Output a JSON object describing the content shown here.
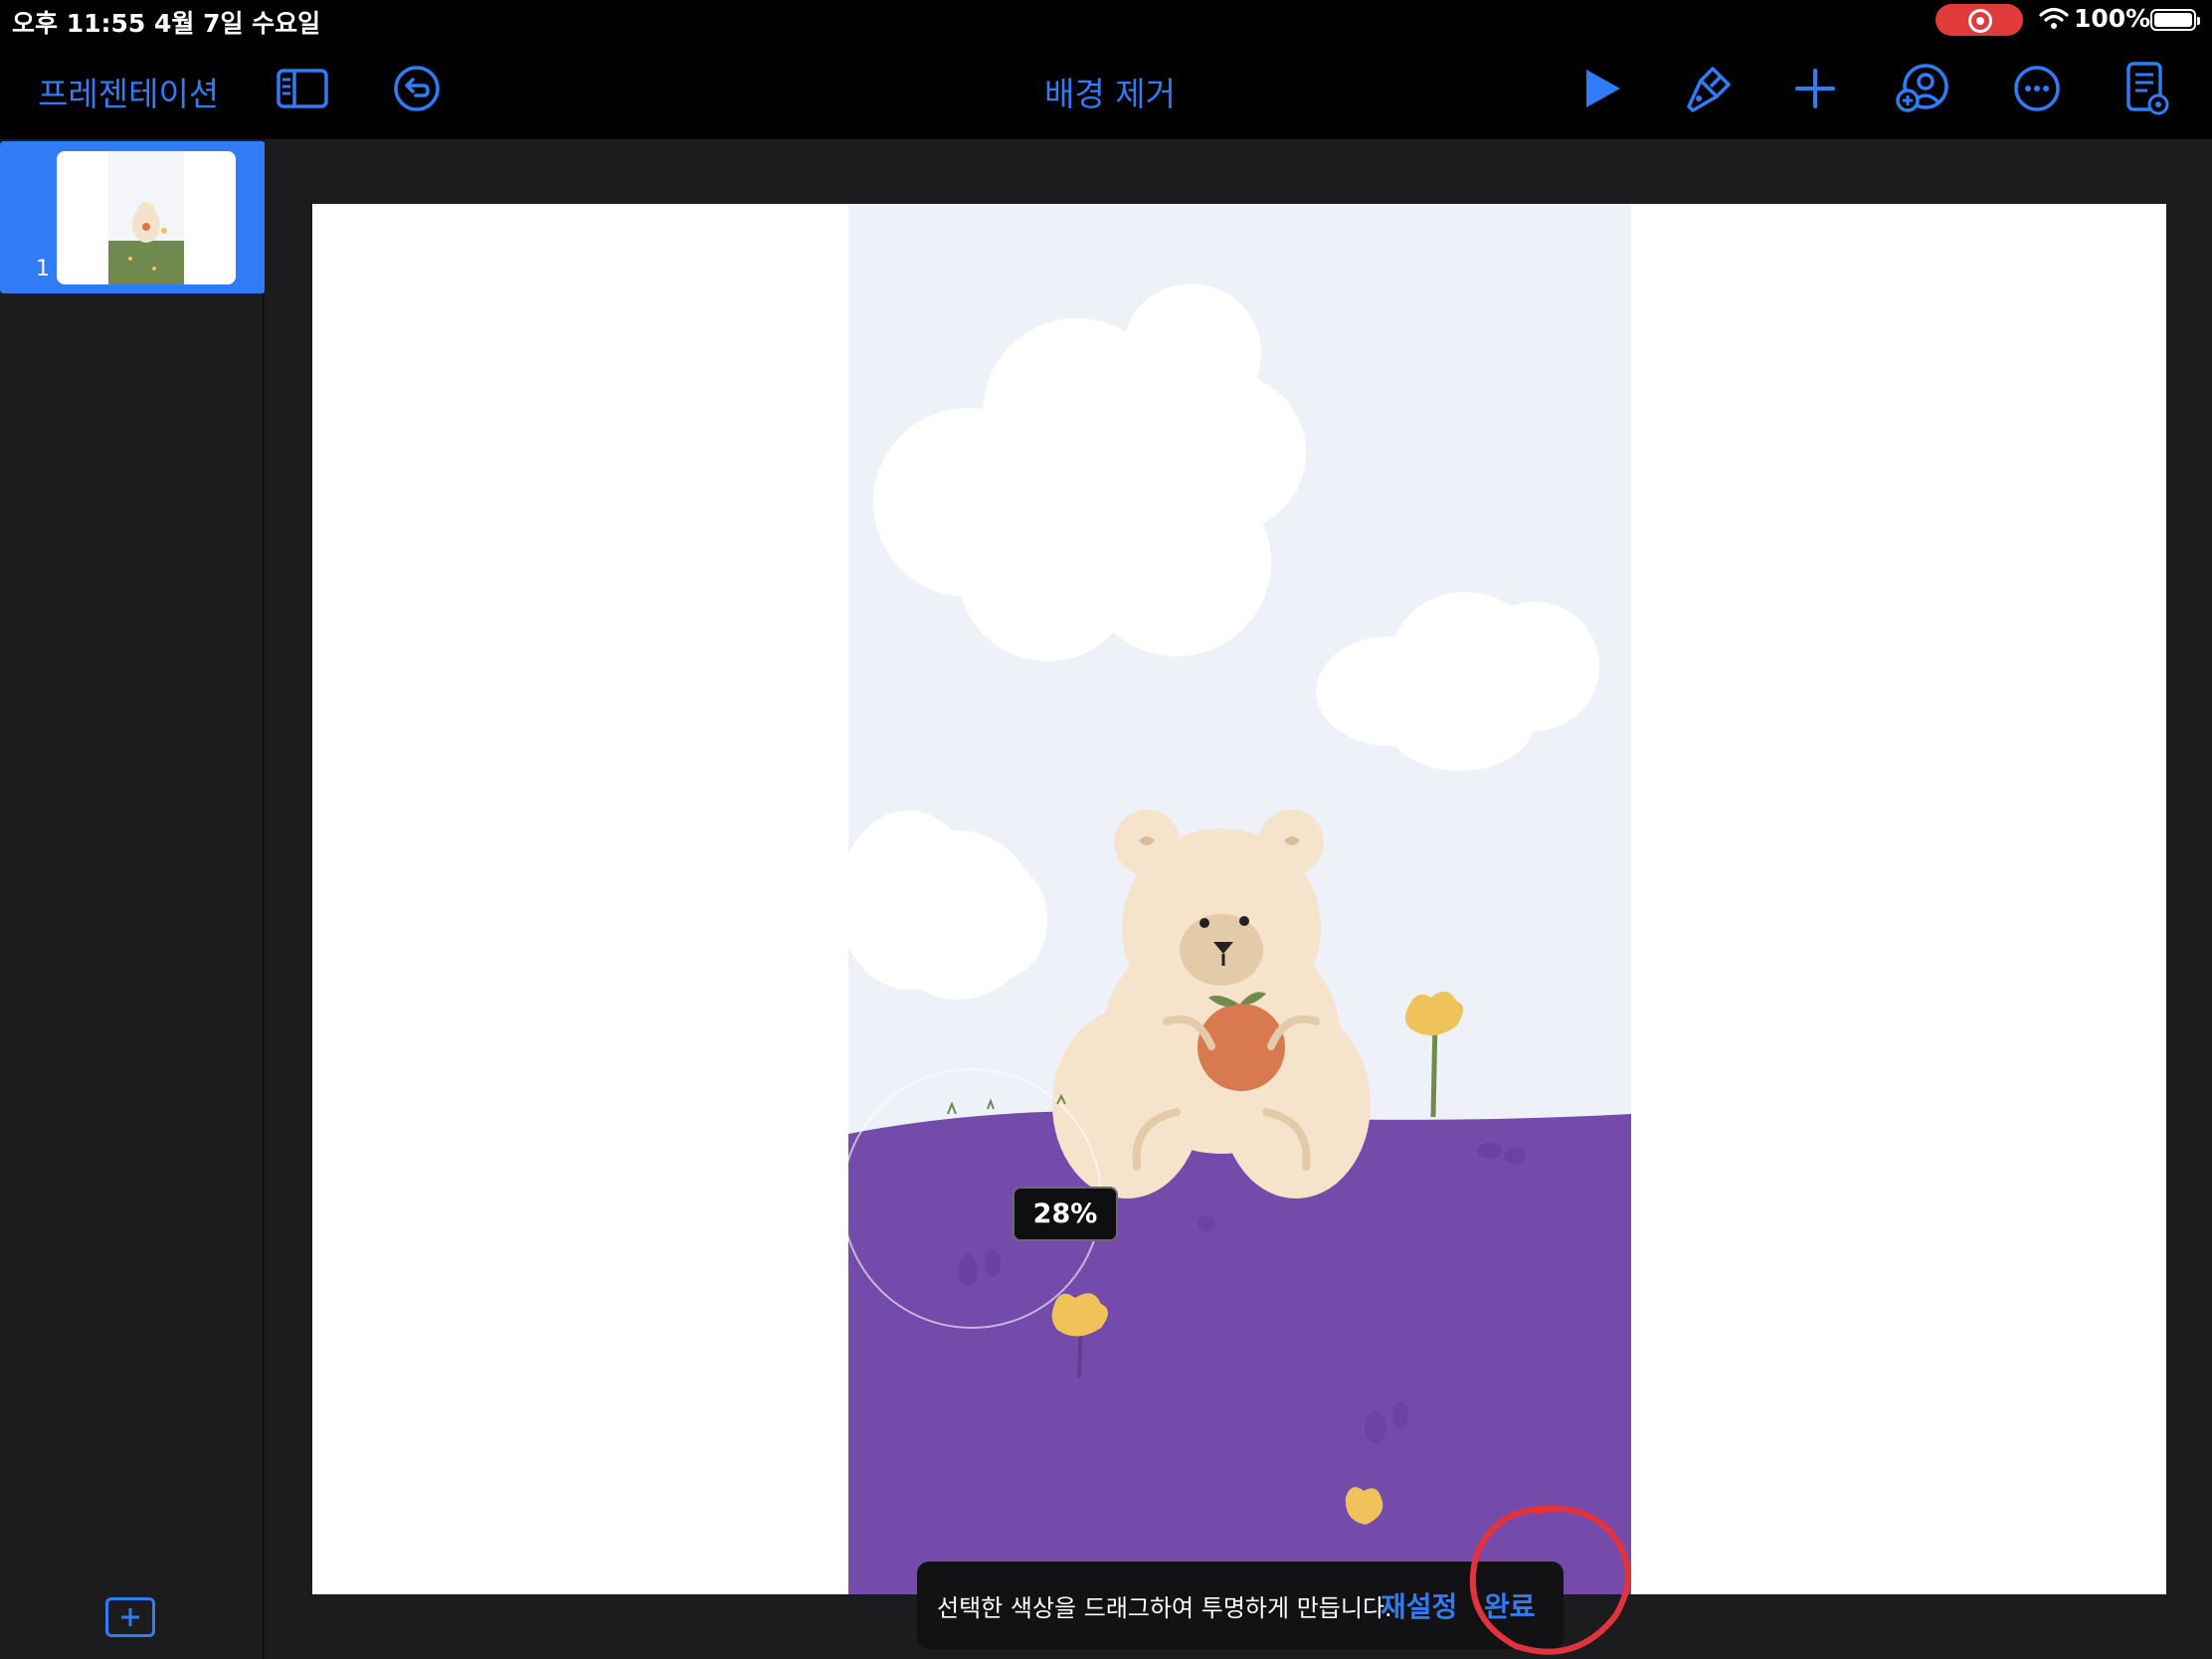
{
  "status_bar": {
    "time_date": "오후 11:55   4월 7일 수요일",
    "battery_percent": "100%",
    "recording": true
  },
  "toolbar": {
    "back_label": "프레젠테이션",
    "title": "배경 제거",
    "icons": [
      "sidebar-toggle-icon",
      "undo-icon",
      "play-icon",
      "format-brush-icon",
      "add-icon",
      "collaborate-icon",
      "more-icon",
      "document-options-icon"
    ]
  },
  "sidebar": {
    "slides": [
      {
        "number": "1",
        "selected": true
      }
    ]
  },
  "editor": {
    "tolerance_percent": "28%"
  },
  "hint_bar": {
    "message": "선택한 색상을 드래그하여 투명하게 만듭니다.",
    "reset_label": "재설정",
    "done_label": "완료"
  },
  "colors": {
    "accent": "#2f7cf6",
    "background": "#1c1c1e",
    "sky": "#eef1f8",
    "ground": "#744bab",
    "annotation": "#e2323b"
  }
}
